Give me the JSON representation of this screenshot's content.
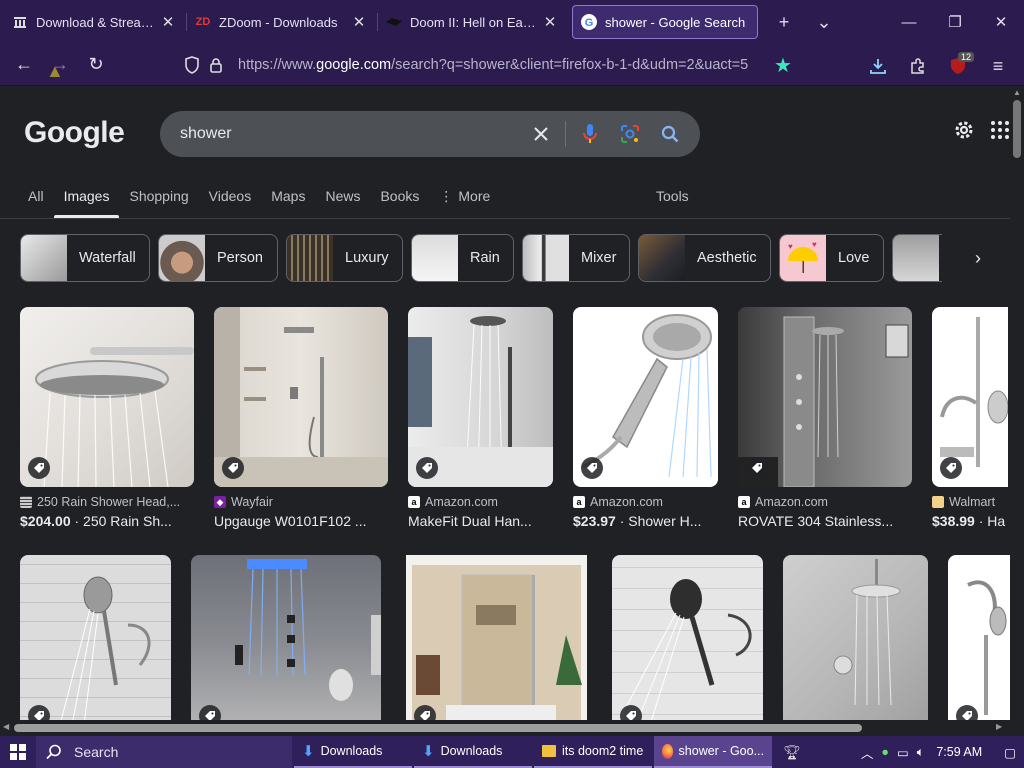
{
  "browser": {
    "tabs": [
      {
        "title": "Download & Streaming :",
        "icon": "archive-icon",
        "active": false
      },
      {
        "title": "ZDoom - Downloads",
        "icon": "zdoom-icon",
        "active": false
      },
      {
        "title": "Doom II: Hell on Earth (D",
        "icon": "doom-icon",
        "active": false
      },
      {
        "title": "shower - Google Search",
        "icon": "google-icon",
        "active": true
      }
    ],
    "url_prefix": "https://www.",
    "url_host": "google.com",
    "url_path": "/search?q=shower&client=firefox-b-1-d&udm=2&uact=5",
    "extension_badge": "12"
  },
  "google": {
    "logo": "Google",
    "query": "shower",
    "nav_tabs": [
      "All",
      "Images",
      "Shopping",
      "Videos",
      "Maps",
      "News",
      "Books",
      "More"
    ],
    "active_tab": "Images",
    "tools_label": "Tools",
    "chips": [
      "Waterfall",
      "Person",
      "Luxury",
      "Rain",
      "Mixer",
      "Aesthetic",
      "Love",
      ""
    ]
  },
  "results": [
    {
      "source": "250 Rain Shower Head,...",
      "price": "$204.00",
      "title": " · 250 Rain Sh..."
    },
    {
      "source": "Wayfair",
      "price": "",
      "title": "Upgauge W0101F102 ..."
    },
    {
      "source": "Amazon.com",
      "price": "",
      "title": "MakeFit Dual Han..."
    },
    {
      "source": "Amazon.com",
      "price": "$23.97",
      "title": " · Shower H..."
    },
    {
      "source": "Amazon.com",
      "price": "",
      "title": "ROVATE 304 Stainless..."
    },
    {
      "source": "Walmart",
      "price": "$38.99",
      "title": " · Ha"
    }
  ],
  "taskbar": {
    "search_label": "Search",
    "apps": [
      "Downloads",
      "Downloads",
      "its doom2 time",
      "shower - Goo..."
    ],
    "time": "7:59 AM"
  },
  "colors": {
    "browser_chrome": "#2b1b4f",
    "page_bg": "#202124",
    "search_bg": "#4d5156",
    "bookmark_star": "#3ee6c0"
  }
}
